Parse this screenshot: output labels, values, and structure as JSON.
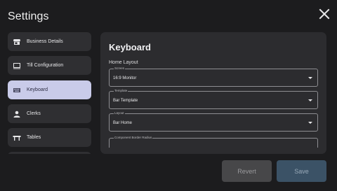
{
  "header": {
    "title": "Settings"
  },
  "sidebar": {
    "items": [
      {
        "label": "Business Details",
        "icon": "storefront-icon"
      },
      {
        "label": "Till Configuration",
        "icon": "monitor-icon"
      },
      {
        "label": "Keyboard",
        "icon": "keyboard-icon",
        "active": true
      },
      {
        "label": "Clerks",
        "icon": "person-icon"
      },
      {
        "label": "Tables",
        "icon": "table-icon"
      }
    ]
  },
  "panel": {
    "title": "Keyboard",
    "section_label": "Home Layout",
    "fields": [
      {
        "caption": "Screen",
        "value": "16:9 Monitor"
      },
      {
        "caption": "Template",
        "value": "Bar Template"
      },
      {
        "caption": "Layout",
        "value": "Bar Home"
      },
      {
        "caption": "Component Border Radius",
        "value": ""
      }
    ]
  },
  "actions": {
    "revert_label": "Revert",
    "save_label": "Save"
  },
  "colors": {
    "background": "#1c1c1e",
    "panel": "#2c2c2f",
    "nav_item": "#2f2f32",
    "nav_active": "#c9cbe9",
    "revert_bg": "#474749",
    "save_bg": "#3b5266"
  }
}
